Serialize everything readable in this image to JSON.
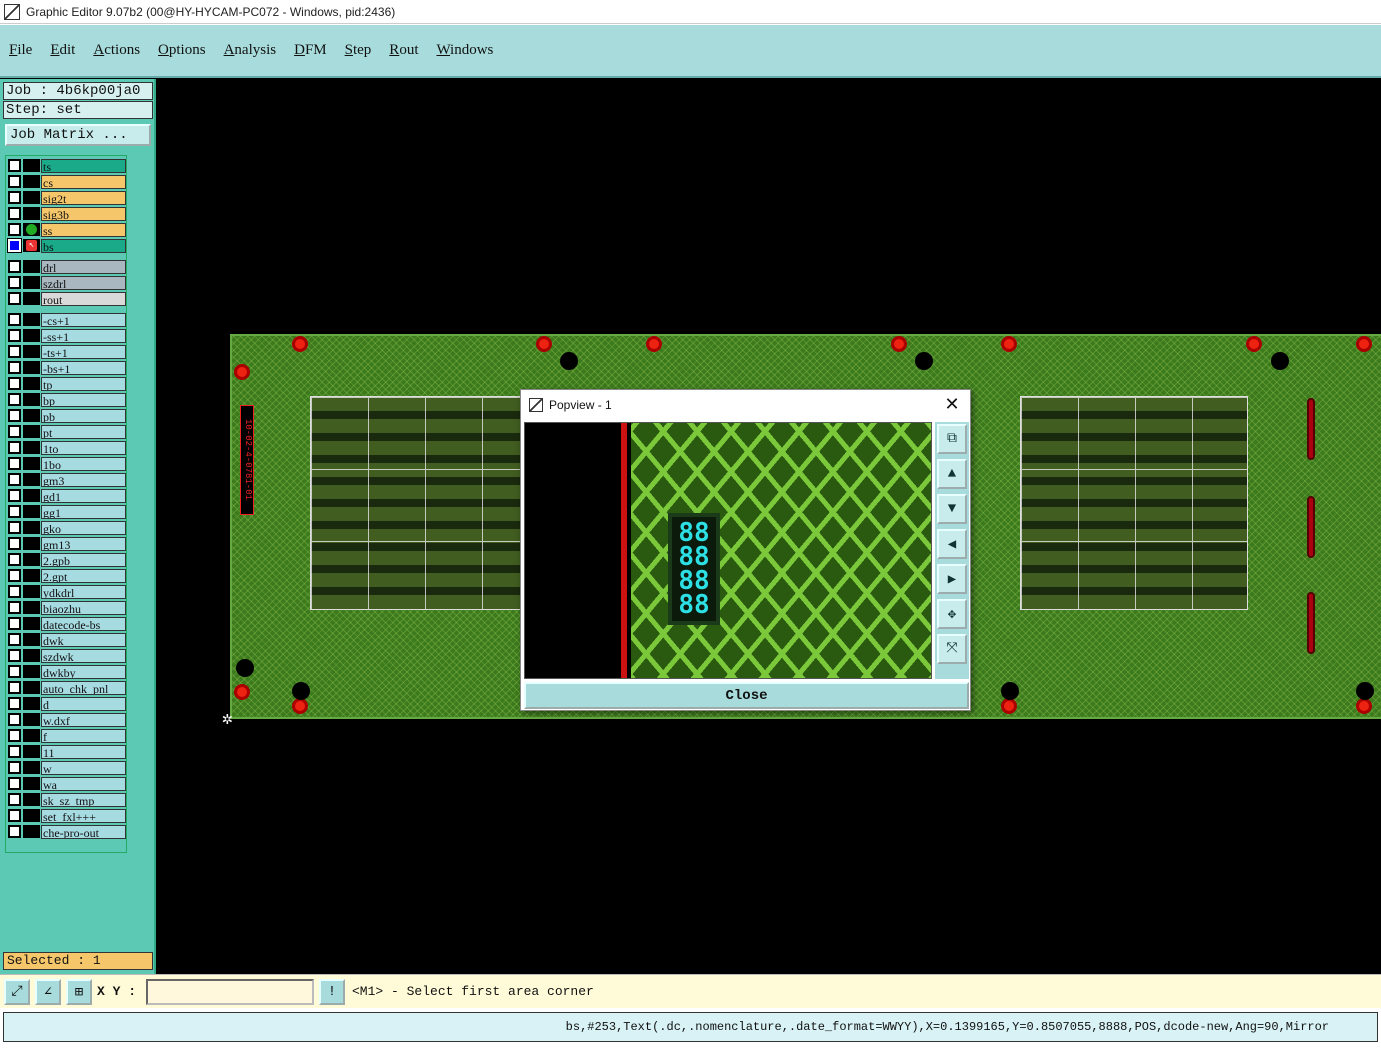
{
  "window": {
    "title": "Graphic Editor 9.07b2 (00@HY-HYCAM-PC072 - Windows, pid:2436)"
  },
  "menu": [
    "File",
    "Edit",
    "Actions",
    "Options",
    "Analysis",
    "DFM",
    "Step",
    "Rout",
    "Windows"
  ],
  "job": {
    "label": "Job : 4b6kp00ja0",
    "step": "Step: set",
    "matrix_button": "Job Matrix ..."
  },
  "layers": [
    {
      "name": "ts",
      "type": "board",
      "active": true
    },
    {
      "name": "cs",
      "type": "board"
    },
    {
      "name": "sig2t",
      "type": "board"
    },
    {
      "name": "sig3b",
      "type": "board"
    },
    {
      "name": "ss",
      "type": "board",
      "marker": "dot"
    },
    {
      "name": "bs",
      "type": "active",
      "checked": true,
      "marker": "arrow"
    },
    {
      "name": "drl",
      "type": "drill"
    },
    {
      "name": "szdrl",
      "type": "drill"
    },
    {
      "name": "rout",
      "type": "rout"
    },
    {
      "name": "-cs+1",
      "type": "misc"
    },
    {
      "name": "-ss+1",
      "type": "misc"
    },
    {
      "name": "-ts+1",
      "type": "misc"
    },
    {
      "name": "-bs+1",
      "type": "misc"
    },
    {
      "name": "tp",
      "type": "misc"
    },
    {
      "name": "bp",
      "type": "misc"
    },
    {
      "name": "pb",
      "type": "misc"
    },
    {
      "name": "pt",
      "type": "misc"
    },
    {
      "name": "1to",
      "type": "misc"
    },
    {
      "name": "1bo",
      "type": "misc"
    },
    {
      "name": "gm3",
      "type": "misc"
    },
    {
      "name": "gd1",
      "type": "misc"
    },
    {
      "name": "gg1",
      "type": "misc"
    },
    {
      "name": "gko",
      "type": "misc"
    },
    {
      "name": "gm13",
      "type": "misc"
    },
    {
      "name": "2.gpb",
      "type": "misc"
    },
    {
      "name": "2.gpt",
      "type": "misc"
    },
    {
      "name": "ydkdrl",
      "type": "misc"
    },
    {
      "name": "biaozhu",
      "type": "misc"
    },
    {
      "name": "datecode-bs",
      "type": "misc"
    },
    {
      "name": "dwk",
      "type": "misc"
    },
    {
      "name": "szdwk",
      "type": "misc"
    },
    {
      "name": "dwkby",
      "type": "misc"
    },
    {
      "name": "auto_chk_pnl",
      "type": "misc"
    },
    {
      "name": "d",
      "type": "misc"
    },
    {
      "name": "w.dxf",
      "type": "misc"
    },
    {
      "name": "f",
      "type": "misc"
    },
    {
      "name": "11",
      "type": "misc"
    },
    {
      "name": "w",
      "type": "misc"
    },
    {
      "name": "wa",
      "type": "misc"
    },
    {
      "name": "sk_sz_tmp",
      "type": "misc"
    },
    {
      "name": "set_fxl+++",
      "type": "misc"
    },
    {
      "name": "che-pro-out",
      "type": "misc"
    }
  ],
  "selected": "Selected : 1",
  "popview": {
    "title": "Popview - 1",
    "close_label": "Close",
    "datecode": "88\n88\n88\n88"
  },
  "board": {
    "side_text": "10-02-4-0781-01"
  },
  "toolbar": {
    "xy_label": "X Y :",
    "xy_value": "",
    "prompt": "<M1> - Select first area corner"
  },
  "status": {
    "text": "bs,#253,Text(.dc,.nomenclature,.date_format=WWYY),X=0.1399165,Y=0.8507055,8888,POS,dcode-new,Ang=90,Mirror"
  }
}
